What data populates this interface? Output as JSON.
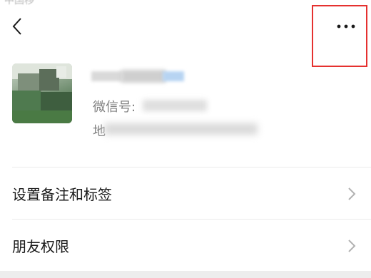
{
  "status_bar": {
    "partial_text": "中国移"
  },
  "header": {
    "back_icon": "chevron-left-icon",
    "more_icon": "more-dots-icon"
  },
  "profile": {
    "wechat_id_label": "微信号:",
    "region_label": "地"
  },
  "rows": [
    {
      "label": "设置备注和标签"
    },
    {
      "label": "朋友权限"
    }
  ],
  "colors": {
    "highlight": "#e5312f",
    "text": "#191919",
    "secondary": "#7f7f7f",
    "chevron": "#b2b2b2"
  }
}
